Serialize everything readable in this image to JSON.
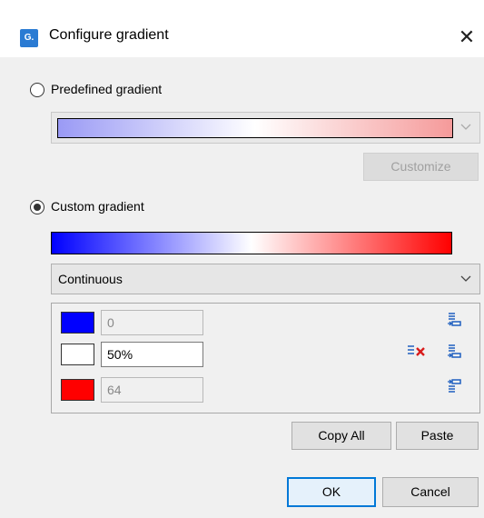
{
  "window": {
    "title": "Configure gradient",
    "icon_text": "G.",
    "close_glyph": "✕"
  },
  "predefined": {
    "label": "Predefined gradient",
    "selected": false,
    "gradient_colors": [
      "#9a9af5",
      "#ffffff",
      "#f59a9a"
    ],
    "customize_label": "Customize"
  },
  "custom": {
    "label": "Custom gradient",
    "selected": true,
    "gradient_colors": [
      "#0000ff",
      "#ffffff",
      "#ff0000"
    ],
    "mode": "Continuous",
    "stops": [
      {
        "color": "#0000ff",
        "value": "0",
        "editable": false
      },
      {
        "color": "#ffffff",
        "value": "50%",
        "editable": true
      },
      {
        "color": "#ff0000",
        "value": "64",
        "editable": false
      }
    ],
    "copy_all_label": "Copy All",
    "paste_label": "Paste"
  },
  "footer": {
    "ok_label": "OK",
    "cancel_label": "Cancel"
  },
  "accent": "#0078d7"
}
